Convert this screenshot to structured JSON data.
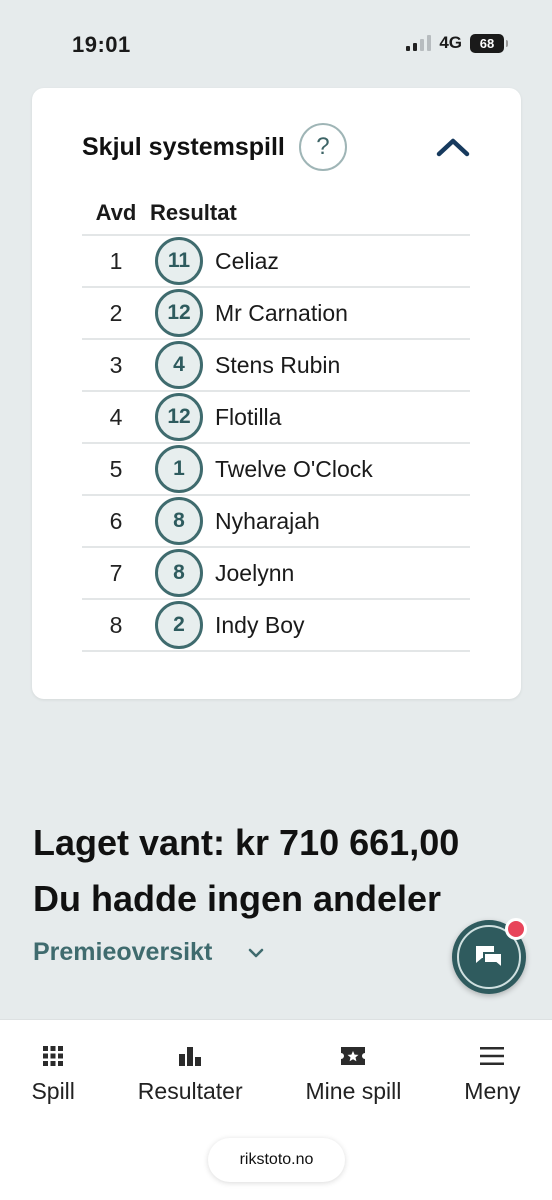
{
  "status_bar": {
    "time": "19:01",
    "network": "4G",
    "battery": "68"
  },
  "system_panel": {
    "title": "Skjul systemspill",
    "help_symbol": "?",
    "table": {
      "headers": [
        "Avd",
        "Resultat"
      ],
      "rows": [
        {
          "avd": "1",
          "number": "11",
          "horse": "Celiaz"
        },
        {
          "avd": "2",
          "number": "12",
          "horse": "Mr Carnation"
        },
        {
          "avd": "3",
          "number": "4",
          "horse": "Stens Rubin"
        },
        {
          "avd": "4",
          "number": "12",
          "horse": "Flotilla"
        },
        {
          "avd": "5",
          "number": "1",
          "horse": "Twelve O'Clock"
        },
        {
          "avd": "6",
          "number": "8",
          "horse": "Nyharajah"
        },
        {
          "avd": "7",
          "number": "8",
          "horse": "Joelynn"
        },
        {
          "avd": "8",
          "number": "2",
          "horse": "Indy Boy"
        }
      ]
    }
  },
  "summary": {
    "team_won": "Laget vant: kr 710 661,00",
    "shares": "Du hadde ingen andeler",
    "prize_overview": "Premieoversikt"
  },
  "bottom_nav": {
    "items": [
      {
        "label": "Spill",
        "icon": "grid-icon"
      },
      {
        "label": "Resultater",
        "icon": "bar-chart-icon"
      },
      {
        "label": "Mine spill",
        "icon": "ticket-icon"
      },
      {
        "label": "Meny",
        "icon": "menu-icon"
      }
    ]
  },
  "browser": {
    "url": "rikstoto.no"
  },
  "colors": {
    "background": "#e6ebec",
    "accent": "#3f6b6e",
    "chat_button": "#2f5b5e",
    "notification": "#e8445a",
    "collapse_chevron": "#173a5e"
  }
}
